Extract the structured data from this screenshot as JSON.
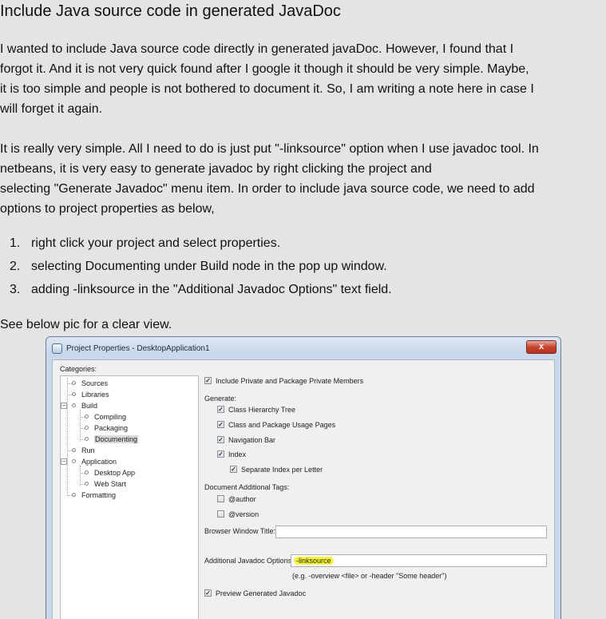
{
  "article": {
    "title": "Include Java source code in generated JavaDoc",
    "para1_lines": [
      "I wanted to include Java source code directly in generated javaDoc. However, I found that I",
      "forgot it. And it is not very quick found after I google it though it should be very simple. Maybe,",
      "it is too simple and people is not bothered to document it. So, I am writing a note here in case I",
      "will forget it again."
    ],
    "para2_lines": [
      "It is really very simple. All I need to do is just put \"-linksource\" option when I use javadoc tool. In",
      "netbeans, it is very easy to generate javadoc by right clicking the project and",
      "selecting \"Generate Javadoc\" menu item. In order to include java source code, we need to add",
      "options to project properties as below,"
    ],
    "steps": [
      {
        "num": "1.",
        "text": "right click your project and select properties."
      },
      {
        "num": "2.",
        "text": "selecting Documenting under Build node in the pop up window."
      },
      {
        "num": "3.",
        "text": "adding -linksource in the \"Additional Javadoc Options\" text field."
      }
    ],
    "see_below": "See below pic for a clear view."
  },
  "dialog": {
    "title": "Project Properties - DesktopApplication1",
    "close_glyph": "x",
    "categories_label": "Categories:",
    "tree": [
      {
        "label": "Sources"
      },
      {
        "label": "Libraries"
      },
      {
        "label": "Build",
        "expander": "−"
      },
      {
        "label": "Compiling"
      },
      {
        "label": "Packaging"
      },
      {
        "label": "Documenting",
        "selected": true
      },
      {
        "label": "Run"
      },
      {
        "label": "Application",
        "expander": "−"
      },
      {
        "label": "Desktop App"
      },
      {
        "label": "Web Start"
      },
      {
        "label": "Formatting"
      }
    ],
    "include_private": "Include Private and Package Private Members",
    "generate_label": "Generate:",
    "generate_options": [
      "Class Hierarchy Tree",
      "Class and Package Usage Pages",
      "Navigation Bar",
      "Index",
      "Separate Index per Letter"
    ],
    "doc_tags_label": "Document Additional Tags:",
    "doc_tags": [
      "@author",
      "@version"
    ],
    "browser_title_label": "Browser Window Title:",
    "browser_title_value": "",
    "javadoc_options_label": "Additional Javadoc Options:",
    "javadoc_options_value": "-linksource",
    "javadoc_hint": "(e.g. -overview <file> or -header \"Some header\")",
    "preview_label": "Preview Generated Javadoc",
    "check_glyph": "✓"
  }
}
